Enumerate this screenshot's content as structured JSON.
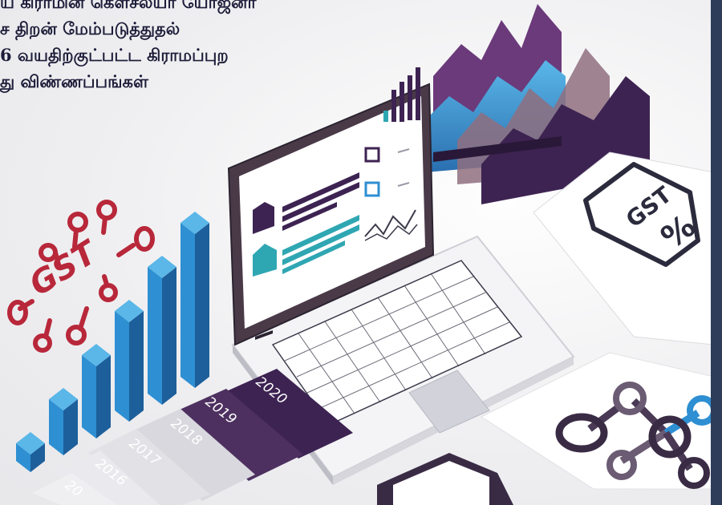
{
  "headline": {
    "line1": "ய கிராமின் கௌசல்யா யோஜனா",
    "line2": "ச திறன் மேம்படுத்துதல்",
    "line3": "6 வயதிற்குட்பட்ட கிராமப்புற",
    "line4": "து விண்ணப்பங்கள்"
  },
  "illustration": {
    "years": [
      "2020",
      "2019",
      "2018",
      "2017",
      "2016",
      "20"
    ],
    "document_label": "GST",
    "document_symbol": "%",
    "gst_doodle": "GST",
    "bar_values": [
      1,
      2,
      3,
      4,
      5,
      6
    ],
    "colors": {
      "purple_dark": "#3d2352",
      "purple": "#6b3a7a",
      "blue": "#2e8fd2",
      "light_blue": "#5ab7e8",
      "teal": "#2fa7b3",
      "frame": "#2e3d5a",
      "doodle_red": "#b8283a"
    }
  }
}
